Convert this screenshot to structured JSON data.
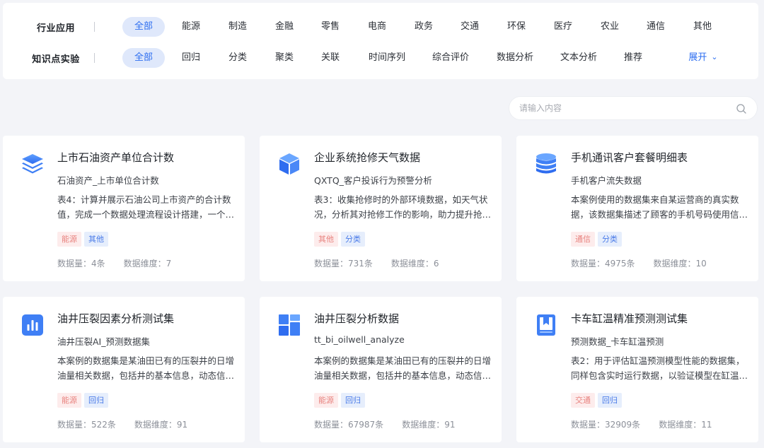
{
  "filters": {
    "industry": {
      "label": "行业应用",
      "options": [
        "全部",
        "能源",
        "制造",
        "金融",
        "零售",
        "电商",
        "政务",
        "交通",
        "环保",
        "医疗",
        "农业",
        "通信",
        "其他"
      ]
    },
    "knowledge": {
      "label": "知识点实验",
      "options": [
        "全部",
        "回归",
        "分类",
        "聚类",
        "关联",
        "时间序列",
        "综合评价",
        "数据分析",
        "文本分析",
        "推荐"
      ],
      "expand_label": "展开"
    }
  },
  "search": {
    "placeholder": "请输入内容"
  },
  "cards": [
    {
      "icon": "layers-icon",
      "title": "上市石油资产单位合计数",
      "subtitle": "石油资产_上市单位合计数",
      "desc": "表4：计算并展示石油公司上市资产的合计数值，完成一个数据处理流程设计搭建，一个…",
      "tags": [
        {
          "text": "能源",
          "color": "red"
        },
        {
          "text": "其他",
          "color": "blue"
        }
      ],
      "count_label": "数据量：4条",
      "dim_label": "数据维度：7"
    },
    {
      "icon": "cube-icon",
      "title": "企业系统抢修天气数据",
      "subtitle": "QXTQ_客户投诉行为预警分析",
      "desc": "表3：收集抢修时的外部环境数据，如天气状况，分析其对抢修工作的影响，助力提升抢…",
      "tags": [
        {
          "text": "其他",
          "color": "red"
        },
        {
          "text": "分类",
          "color": "blue"
        }
      ],
      "count_label": "数据量：731条",
      "dim_label": "数据维度：6"
    },
    {
      "icon": "database-icon",
      "title": "手机通讯客户套餐明细表",
      "subtitle": "手机客户流失数据",
      "desc": "本案例使用的数据集来自某运营商的真实数据，该数据集描述了顾客的手机号码使用信…",
      "tags": [
        {
          "text": "通信",
          "color": "red"
        },
        {
          "text": "分类",
          "color": "blue"
        }
      ],
      "count_label": "数据量：4975条",
      "dim_label": "数据维度：10"
    },
    {
      "icon": "bar-chart-icon",
      "title": "油井压裂因素分析测试集",
      "subtitle": "油井压裂AI_预测数据集",
      "desc": "本案例的数据集是某油田已有的压裂井的日增油量相关数据，包括井的基本信息，动态信…",
      "tags": [
        {
          "text": "能源",
          "color": "red"
        },
        {
          "text": "回归",
          "color": "blue"
        }
      ],
      "count_label": "数据量：522条",
      "dim_label": "数据维度：91"
    },
    {
      "icon": "dashboard-grid-icon",
      "title": "油井压裂分析数据",
      "subtitle": "tt_bi_oilwell_analyze",
      "desc": "本案例的数据集是某油田已有的压裂井的日增油量相关数据，包括井的基本信息，动态信…",
      "tags": [
        {
          "text": "能源",
          "color": "red"
        },
        {
          "text": "回归",
          "color": "blue"
        }
      ],
      "count_label": "数据量：67987条",
      "dim_label": "数据维度：91"
    },
    {
      "icon": "book-icon",
      "title": "卡车缸温精准预测测试集",
      "subtitle": "预测数据_卡车缸温预测",
      "desc": "表2：用于评估缸温预测模型性能的数据集，同样包含实时运行数据，以验证模型在缸温…",
      "tags": [
        {
          "text": "交通",
          "color": "red"
        },
        {
          "text": "回归",
          "color": "blue"
        }
      ],
      "count_label": "数据量：32909条",
      "dim_label": "数据维度：11"
    }
  ]
}
